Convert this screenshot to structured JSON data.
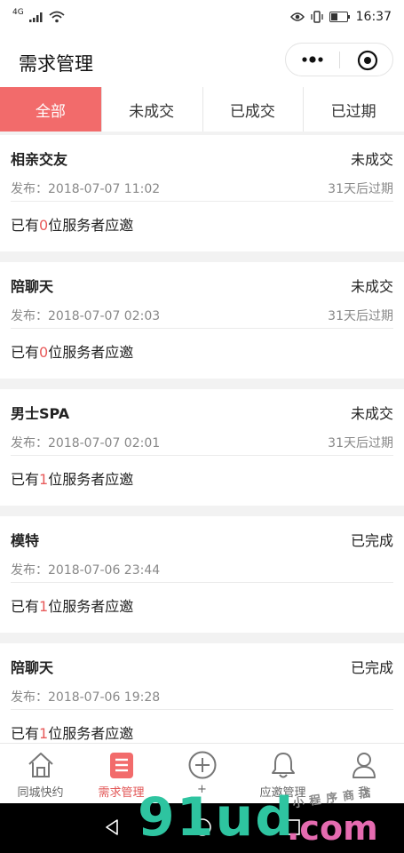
{
  "status_bar": {
    "network": "4G",
    "time": "16:37"
  },
  "header": {
    "title": "需求管理"
  },
  "filter_tabs": [
    {
      "label": "全部",
      "active": true
    },
    {
      "label": "未成交",
      "active": false
    },
    {
      "label": "已成交",
      "active": false
    },
    {
      "label": "已过期",
      "active": false
    }
  ],
  "demands": [
    {
      "title": "相亲交友",
      "status": "未成交",
      "published": "发布：2018-07-07 11:02",
      "expiry": "31天后过期",
      "invite_prefix": "已有",
      "invite_count": "0",
      "invite_suffix": "位服务者应邀"
    },
    {
      "title": "陪聊天",
      "status": "未成交",
      "published": "发布：2018-07-07 02:03",
      "expiry": "31天后过期",
      "invite_prefix": "已有",
      "invite_count": "0",
      "invite_suffix": "位服务者应邀"
    },
    {
      "title": "男士SPA",
      "status": "未成交",
      "published": "发布：2018-07-07 02:01",
      "expiry": "31天后过期",
      "invite_prefix": "已有",
      "invite_count": "1",
      "invite_suffix": "位服务者应邀"
    },
    {
      "title": "模特",
      "status": "已完成",
      "published": "发布：2018-07-06 23:44",
      "expiry": "",
      "invite_prefix": "已有",
      "invite_count": "1",
      "invite_suffix": "位服务者应邀"
    },
    {
      "title": "陪聊天",
      "status": "已完成",
      "published": "发布：2018-07-06 19:28",
      "expiry": "",
      "invite_prefix": "已有",
      "invite_count": "1",
      "invite_suffix": "位服务者应邀"
    }
  ],
  "tabbar": [
    {
      "label": "同城快约",
      "icon": "home-icon",
      "active": false
    },
    {
      "label": "需求管理",
      "icon": "list-icon",
      "active": true
    },
    {
      "label": "+",
      "icon": "plus-circle-icon",
      "active": false
    },
    {
      "label": "应邀管理",
      "icon": "bell-icon",
      "active": false
    },
    {
      "label": "我",
      "icon": "user-icon",
      "active": false
    }
  ],
  "watermark": {
    "main": "91ud",
    "suffix": ".com",
    "sub": "小程序商店"
  },
  "colors": {
    "accent": "#f26b6b",
    "active_text": "#e25555",
    "count": "#e85b5b"
  }
}
